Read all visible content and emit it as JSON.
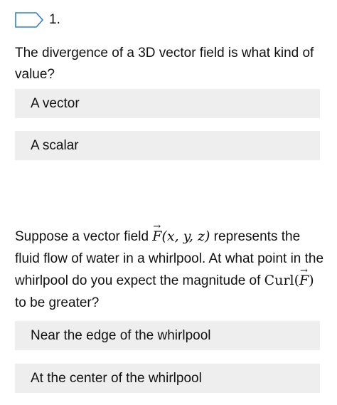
{
  "question1": {
    "number": "1.",
    "text": "The divergence of a 3D vector field is what kind of value?",
    "options": [
      "A vector",
      "A scalar"
    ]
  },
  "question2": {
    "text_part1": "Suppose a vector field ",
    "math_field": "F",
    "math_args": "(x, y, z)",
    "text_part2": " represents the fluid flow of water in a whirlpool.  At what point in the whirlpool do you expect the magnitude of ",
    "math_curl": "Curl(",
    "math_curl_field": "F",
    "math_curl_close": ")",
    "text_part3": " to be greater?",
    "options": [
      "Near the edge of the whirlpool",
      "At the center of the whirlpool"
    ]
  },
  "colors": {
    "accent": "#2f7fd8",
    "option_bg": "#eeeeee"
  }
}
